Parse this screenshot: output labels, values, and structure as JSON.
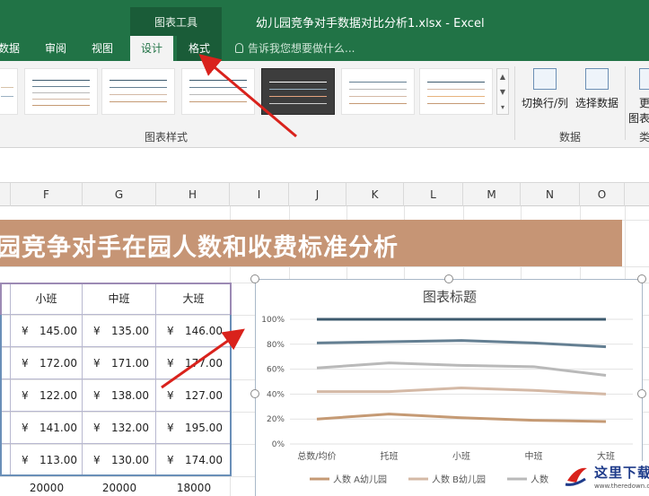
{
  "window": {
    "contextual_group": "图表工具",
    "title": "幼儿园竞争对手数据对比分析1.xlsx - Excel"
  },
  "tabs": {
    "data": "数据",
    "review": "审阅",
    "view": "视图",
    "design": "设计",
    "format": "格式",
    "tell_me": "告诉我您想要做什么..."
  },
  "ribbon": {
    "chart_styles_label": "图表样式",
    "data_group_label": "数据",
    "type_group_label": "类",
    "switch_row_col": "切换行/列",
    "select_data": "选择数据",
    "change_type_line1": "更",
    "change_type_line2": "图表"
  },
  "columns": [
    "F",
    "G",
    "H",
    "I",
    "J",
    "K",
    "L",
    "M",
    "N",
    "O"
  ],
  "sheet": {
    "banner": "园竞争对手在园人数和收费标准分析"
  },
  "table": {
    "headers": [
      "小班",
      "中班",
      "大班"
    ],
    "currency": "¥",
    "rows": [
      [
        "145.00",
        "135.00",
        "146.00"
      ],
      [
        "172.00",
        "171.00",
        "177.00"
      ],
      [
        "122.00",
        "138.00",
        "127.00"
      ],
      [
        "141.00",
        "132.00",
        "195.00"
      ],
      [
        "113.00",
        "130.00",
        "174.00"
      ]
    ],
    "totals": [
      "20000",
      "20000",
      "18000"
    ]
  },
  "chart_data": {
    "type": "line",
    "title": "图表标题",
    "categories": [
      "总数/均价",
      "托班",
      "小班",
      "中班",
      "大班"
    ],
    "ylim": [
      0,
      100
    ],
    "yticks": [
      "0%",
      "20%",
      "40%",
      "60%",
      "80%",
      "100%"
    ],
    "grid": true,
    "legend_position": "bottom",
    "series": [
      {
        "name": "人数 A幼儿园",
        "color": "#c59a74",
        "values": [
          20,
          24,
          21,
          19,
          18
        ]
      },
      {
        "name": "人数 B幼儿园",
        "color": "#d4b9a6",
        "values": [
          42,
          42,
          45,
          43,
          40
        ]
      },
      {
        "name": "人数",
        "color": "#b9b9b9",
        "values": [
          61,
          65,
          63,
          62,
          55
        ]
      },
      {
        "color": "#647f92",
        "values": [
          81,
          82,
          83,
          81,
          78
        ]
      },
      {
        "color": "#3d5a6e",
        "values": [
          100,
          100,
          100,
          100,
          100
        ]
      }
    ]
  },
  "watermark": {
    "cn": "这里下载",
    "url": "www.theredown.com"
  }
}
